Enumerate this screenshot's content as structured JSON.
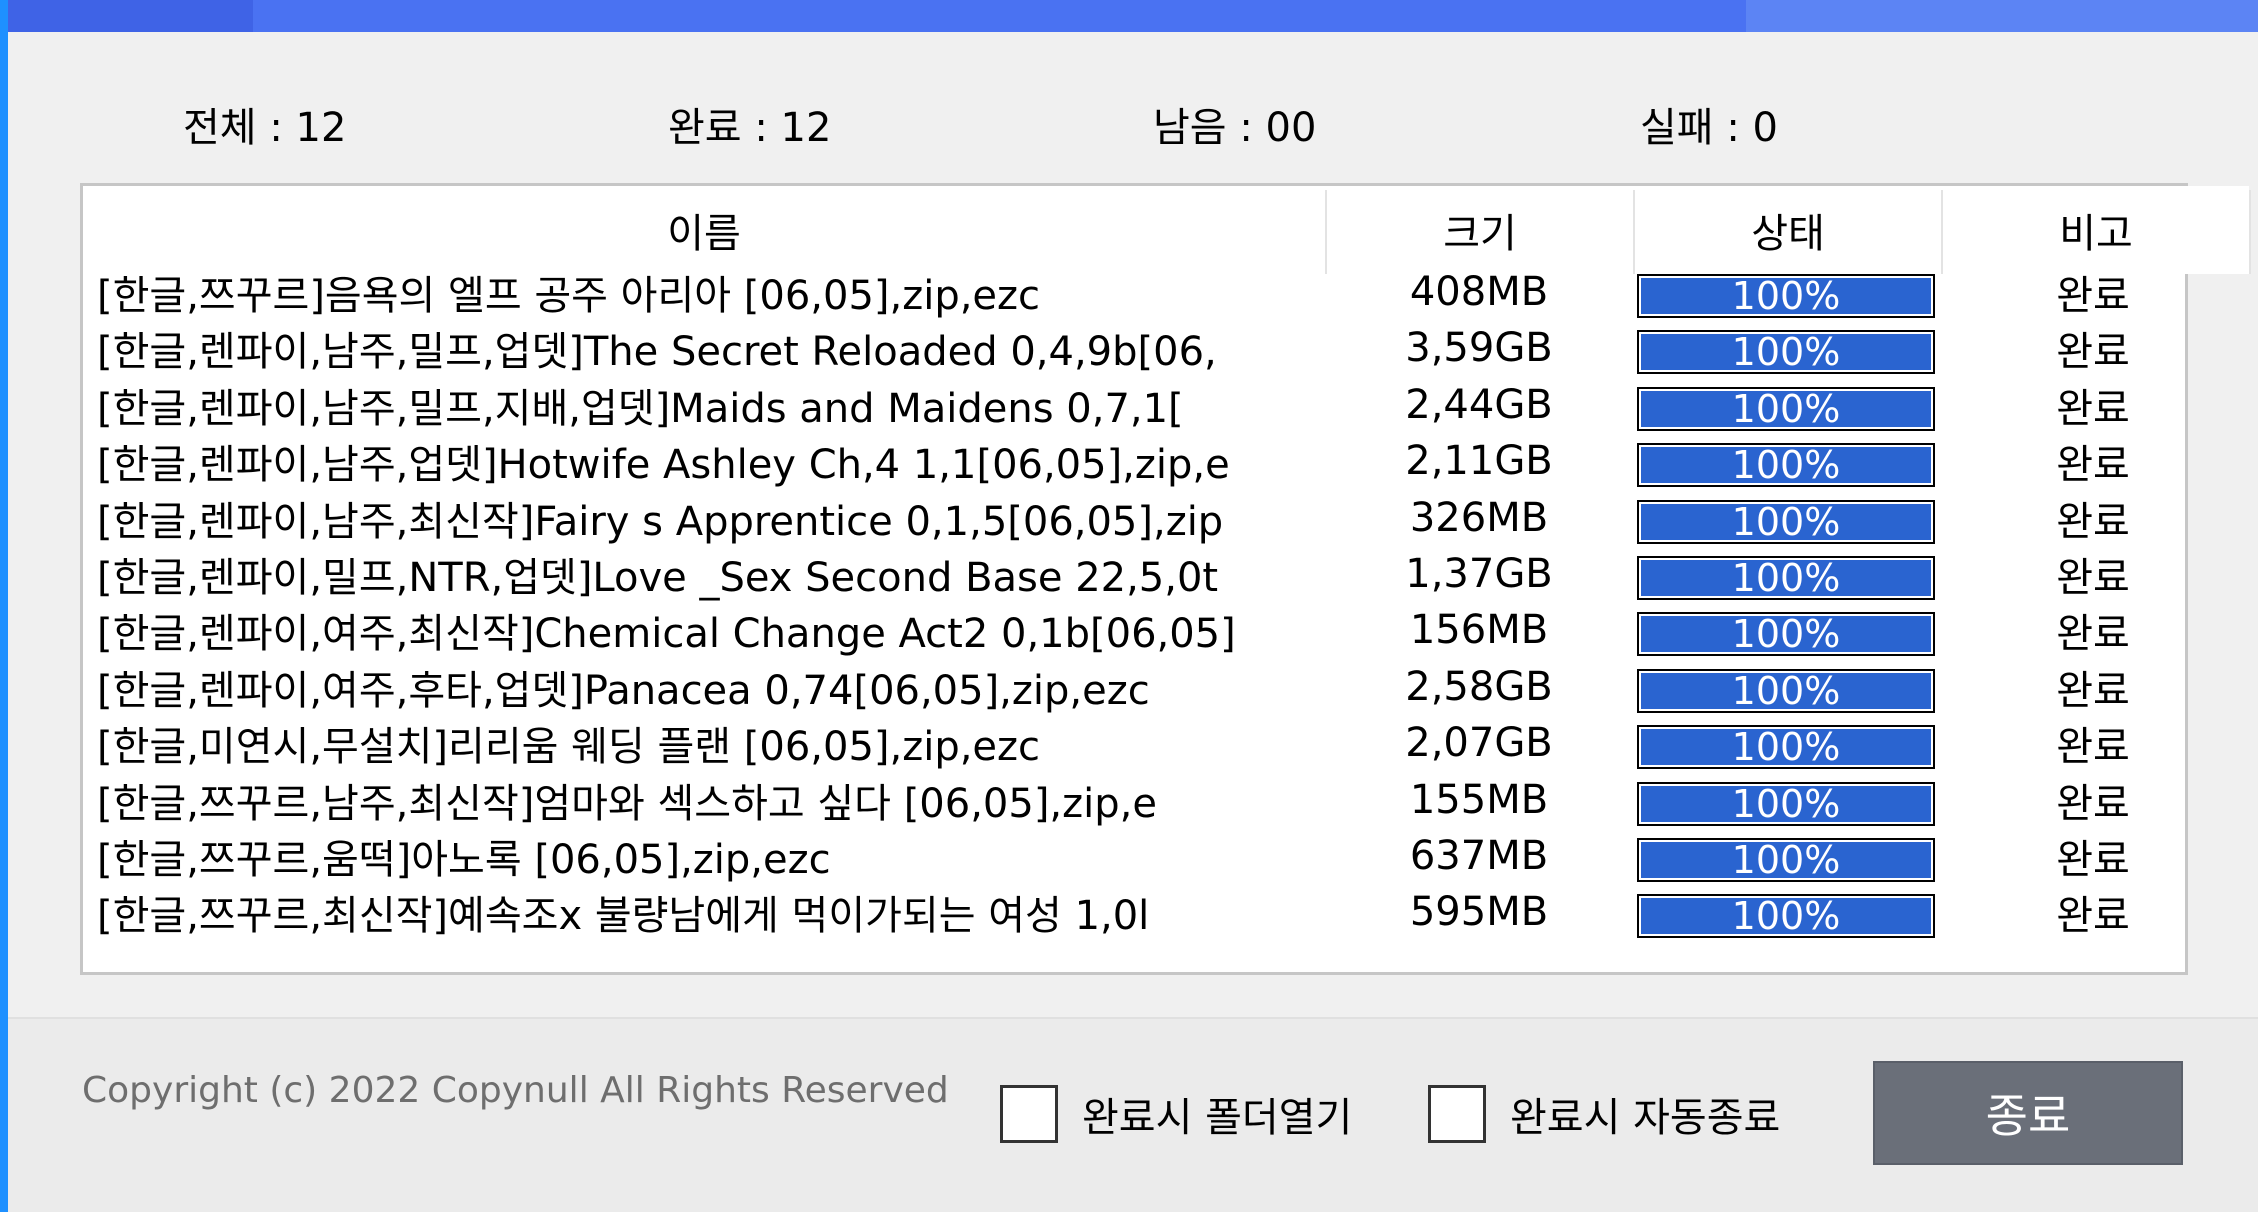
{
  "colors": {
    "accent": "#4a72f2",
    "progress": "#2a64d0",
    "button": "#6a6f79"
  },
  "stats": {
    "total": "전체 : 12",
    "done": "완료 : 12",
    "remaining": "남음 : 00",
    "failed": "실패 : 0"
  },
  "columns": [
    "이름",
    "크기",
    "상태",
    "비고"
  ],
  "rows": [
    {
      "name": "[한글,쯔꾸르]음욕의 엘프 공주 아리아 [06,05],zip,ezc",
      "size": "408MB",
      "progress": 100,
      "progress_label": "100%",
      "note": "완료"
    },
    {
      "name": "[한글,렌파이,남주,밀프,업뎃]The Secret Reloaded 0,4,9b[06,",
      "size": "3,59GB",
      "progress": 100,
      "progress_label": "100%",
      "note": "완료"
    },
    {
      "name": "[한글,렌파이,남주,밀프,지배,업뎃]Maids and Maidens 0,7,1[",
      "size": "2,44GB",
      "progress": 100,
      "progress_label": "100%",
      "note": "완료"
    },
    {
      "name": "[한글,렌파이,남주,업뎃]Hotwife Ashley Ch,4 1,1[06,05],zip,e",
      "size": "2,11GB",
      "progress": 100,
      "progress_label": "100%",
      "note": "완료"
    },
    {
      "name": "[한글,렌파이,남주,최신작]Fairy s Apprentice 0,1,5[06,05],zip",
      "size": "326MB",
      "progress": 100,
      "progress_label": "100%",
      "note": "완료"
    },
    {
      "name": "[한글,렌파이,밀프,NTR,업뎃]Love _Sex Second Base 22,5,0t",
      "size": "1,37GB",
      "progress": 100,
      "progress_label": "100%",
      "note": "완료"
    },
    {
      "name": "[한글,렌파이,여주,최신작]Chemical Change Act2 0,1b[06,05]",
      "size": "156MB",
      "progress": 100,
      "progress_label": "100%",
      "note": "완료"
    },
    {
      "name": "[한글,렌파이,여주,후타,업뎃]Panacea 0,74[06,05],zip,ezc",
      "size": "2,58GB",
      "progress": 100,
      "progress_label": "100%",
      "note": "완료"
    },
    {
      "name": "[한글,미연시,무설치]리리움 웨딩 플랜 [06,05],zip,ezc",
      "size": "2,07GB",
      "progress": 100,
      "progress_label": "100%",
      "note": "완료"
    },
    {
      "name": "[한글,쯔꾸르,남주,최신작]엄마와 섹스하고 싶다 [06,05],zip,e",
      "size": "155MB",
      "progress": 100,
      "progress_label": "100%",
      "note": "완료"
    },
    {
      "name": "[한글,쯔꾸르,움떡]아노록 [06,05],zip,ezc",
      "size": "637MB",
      "progress": 100,
      "progress_label": "100%",
      "note": "완료"
    },
    {
      "name": "[한글,쯔꾸르,최신작]예속조x 불량남에게 먹이가되는 여성 1,0l",
      "size": "595MB",
      "progress": 100,
      "progress_label": "100%",
      "note": "완료"
    }
  ],
  "footer": {
    "copyright": "Copyright (c) 2022 Copynull All Rights Reserved",
    "open_folder_label": "완료시 폴더열기",
    "auto_exit_label": "완료시 자동종료",
    "close_label": "종료"
  }
}
